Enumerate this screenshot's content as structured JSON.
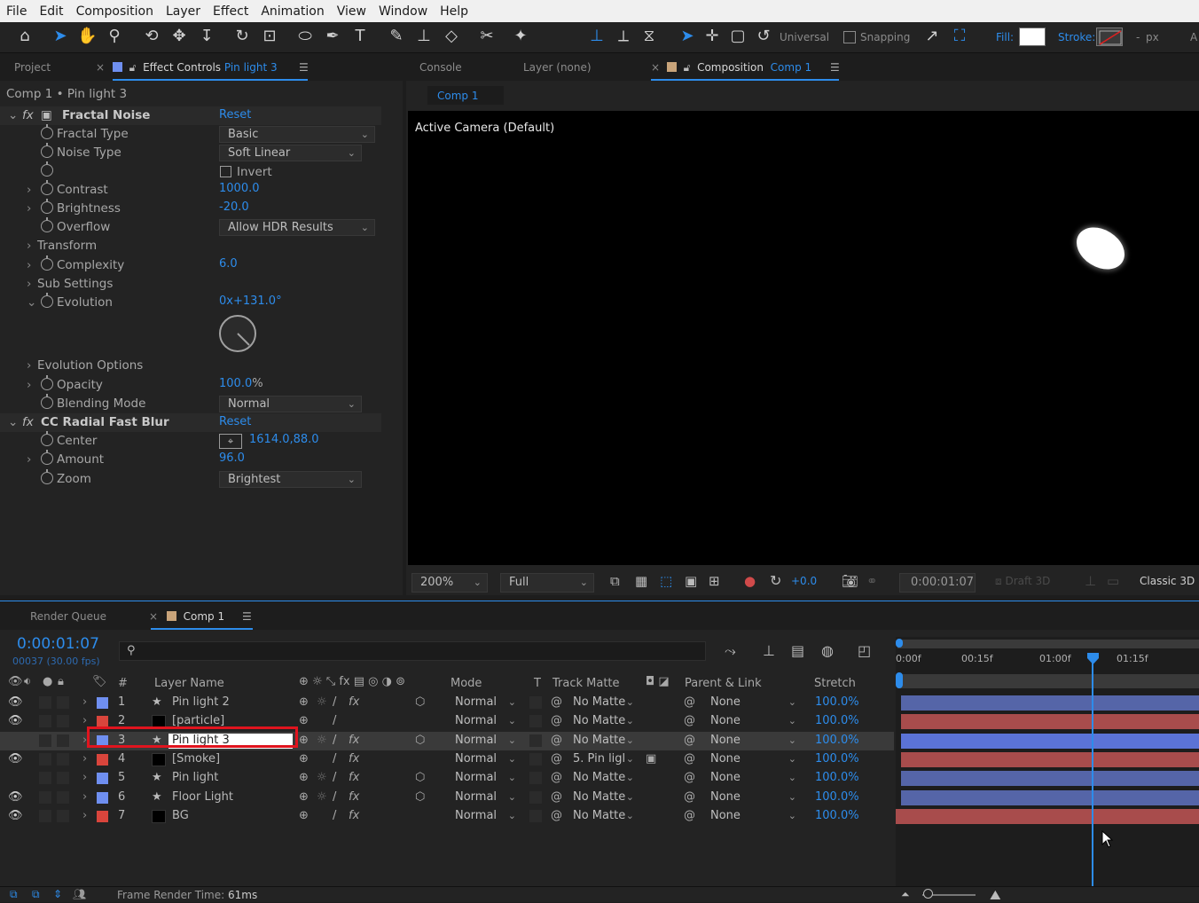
{
  "menu": [
    "File",
    "Edit",
    "Composition",
    "Layer",
    "Effect",
    "Animation",
    "View",
    "Window",
    "Help"
  ],
  "toolbar": {
    "universal": "Universal",
    "snapping": "Snapping",
    "fill": "Fill:",
    "stroke": "Stroke:",
    "px": "px",
    "dash": "-",
    "edge": "A"
  },
  "left_panel": {
    "tab_project": "Project",
    "tab_effect_controls": "Effect Controls",
    "tab_effect_target": "Pin light 3",
    "breadcrumb": "Comp 1 • Pin light 3",
    "effects": [
      {
        "name": "Fractal Noise",
        "reset": "Reset"
      },
      {
        "name": "CC Radial Fast Blur",
        "reset": "Reset"
      }
    ],
    "props": {
      "fractal_type": {
        "label": "Fractal Type",
        "value": "Basic"
      },
      "noise_type": {
        "label": "Noise Type",
        "value": "Soft Linear"
      },
      "invert": {
        "label": "Invert"
      },
      "contrast": {
        "label": "Contrast",
        "value": "1000.0"
      },
      "brightness": {
        "label": "Brightness",
        "value": "-20.0"
      },
      "overflow": {
        "label": "Overflow",
        "value": "Allow HDR Results"
      },
      "transform": {
        "label": "Transform"
      },
      "complexity": {
        "label": "Complexity",
        "value": "6.0"
      },
      "sub_settings": {
        "label": "Sub Settings"
      },
      "evolution": {
        "label": "Evolution",
        "value": "0x+131.0°"
      },
      "evolution_options": {
        "label": "Evolution Options"
      },
      "opacity": {
        "label": "Opacity",
        "value": "100.0",
        "unit": "%"
      },
      "blending_mode": {
        "label": "Blending Mode",
        "value": "Normal"
      },
      "center": {
        "label": "Center",
        "value": "1614.0,88.0"
      },
      "amount": {
        "label": "Amount",
        "value": "96.0"
      },
      "zoom": {
        "label": "Zoom",
        "value": "Brightest"
      }
    }
  },
  "right_panel": {
    "tab_console": "Console",
    "tab_layer": "Layer (none)",
    "tab_composition": "Composition",
    "tab_comp_name": "Comp 1",
    "subtab": "Comp 1",
    "camera_label": "Active Camera (Default)",
    "zoom": "200%",
    "resolution": "Full",
    "exposure": "+0.0",
    "timecode": "0:00:01:07",
    "draft3d": "Draft 3D",
    "renderer": "Classic 3D"
  },
  "timeline": {
    "tab_render_queue": "Render Queue",
    "tab_comp": "Comp 1",
    "timecode": "0:00:01:07",
    "frame_info": "00037 (30.00 fps)",
    "ruler": [
      "0:00f",
      "00:15f",
      "01:00f",
      "01:15f"
    ],
    "headers": {
      "num": "#",
      "layer_name": "Layer Name",
      "mode": "Mode",
      "t": "T",
      "track_matte": "Track Matte",
      "parent": "Parent & Link",
      "stretch": "Stretch"
    },
    "layers": [
      {
        "num": "1",
        "name": "Pin light 2",
        "mode": "Normal",
        "matte": "No Matte",
        "parent": "None",
        "stretch": "100.0%",
        "label_color": "#6f8ff0",
        "bar_color": "#5565a8",
        "visible": true
      },
      {
        "num": "2",
        "name": "[particle]",
        "mode": "Normal",
        "matte": "No Matte",
        "parent": "None",
        "stretch": "100.0%",
        "label_color": "#d9453c",
        "bar_color": "#a84c4c",
        "visible": true
      },
      {
        "num": "3",
        "name": "Pin light 3",
        "mode": "Normal",
        "matte": "No Matte",
        "parent": "None",
        "stretch": "100.0%",
        "label_color": "#6f8ff0",
        "bar_color": "#5565a8",
        "visible": false
      },
      {
        "num": "4",
        "name": "[Smoke]",
        "mode": "Normal",
        "matte": "5. Pin ligl",
        "parent": "None",
        "stretch": "100.0%",
        "label_color": "#d9453c",
        "bar_color": "#a84c4c",
        "visible": true
      },
      {
        "num": "5",
        "name": "Pin light",
        "mode": "Normal",
        "matte": "No Matte",
        "parent": "None",
        "stretch": "100.0%",
        "label_color": "#6f8ff0",
        "bar_color": "#5565a8",
        "visible": false
      },
      {
        "num": "6",
        "name": "Floor Light",
        "mode": "Normal",
        "matte": "No Matte",
        "parent": "None",
        "stretch": "100.0%",
        "label_color": "#6f8ff0",
        "bar_color": "#5565a8",
        "visible": true
      },
      {
        "num": "7",
        "name": "BG",
        "mode": "Normal",
        "matte": "No Matte",
        "parent": "None",
        "stretch": "100.0%",
        "label_color": "#d9453c",
        "bar_color": "#a84c4c",
        "visible": true
      }
    ],
    "footer": {
      "label": "Frame Render Time:",
      "value": "61ms"
    }
  },
  "colors": {
    "accent": "#2d8ceb",
    "selection_box": "#e0141e"
  }
}
